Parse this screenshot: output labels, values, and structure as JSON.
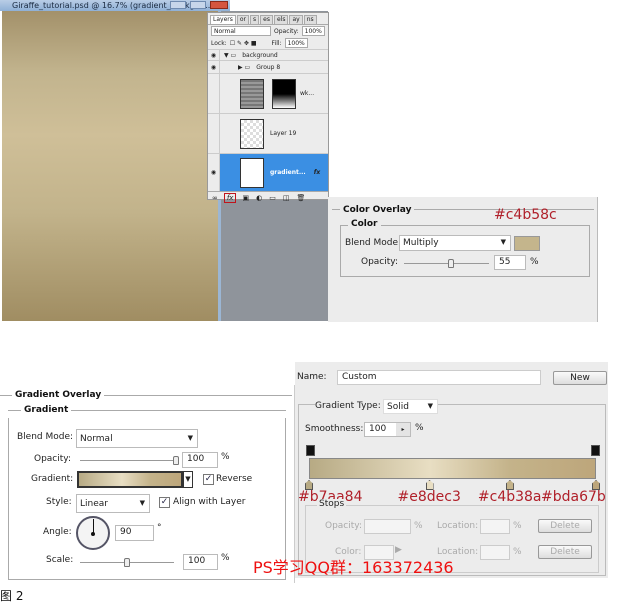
{
  "window": {
    "title": "Giraffe_tutorial.psd @ 16.7% (gradient_backgro...",
    "buttons": [
      "minimize",
      "maximize",
      "close"
    ]
  },
  "layers_panel": {
    "tabs": [
      "Layers",
      "or",
      "s",
      "es",
      "els",
      "ay",
      "ns"
    ],
    "blend_mode": "Normal",
    "opacity_label": "Opacity:",
    "opacity": "100%",
    "lock_label": "Lock:",
    "fill_label": "Fill:",
    "fill": "100%",
    "layers": [
      {
        "name": "background",
        "type": "group-open"
      },
      {
        "name": "Group 8",
        "type": "group"
      },
      {
        "name": "wk...",
        "type": "masked"
      },
      {
        "name": "Layer 19",
        "type": "layer"
      },
      {
        "name": "gradient...",
        "type": "selected",
        "fx": "fx"
      }
    ],
    "footer_icons": [
      "link-icon",
      "fx-icon",
      "mask-icon",
      "adjustment-icon",
      "folder-icon",
      "new-layer-icon",
      "trash-icon"
    ]
  },
  "color_overlay": {
    "title": "Color Overlay",
    "group": "Color",
    "blend_label": "Blend Mode:",
    "blend_mode": "Multiply",
    "color": "#c4b58c",
    "color_annotation": "#c4b58c",
    "opacity_label": "Opacity:",
    "opacity": "55",
    "opacity_pct": 55,
    "unit": "%"
  },
  "gradient_overlay": {
    "title": "Gradient Overlay",
    "group": "Gradient",
    "blend_label": "Blend Mode:",
    "blend_mode": "Normal",
    "opacity_label": "Opacity:",
    "opacity": "100",
    "unit": "%",
    "gradient_label": "Gradient:",
    "reverse_label": "Reverse",
    "reverse": true,
    "style_label": "Style:",
    "style": "Linear",
    "align_label": "Align with Layer",
    "align": true,
    "angle_label": "Angle:",
    "angle": "90",
    "degree": "°",
    "scale_label": "Scale:",
    "scale": "100",
    "scale_pct": 100
  },
  "gradient_editor": {
    "name_label": "Name:",
    "name": "Custom",
    "new_button": "New",
    "type_label": "Gradient Type:",
    "type": "Solid",
    "smooth_label": "Smoothness:",
    "smoothness": "100",
    "unit": "%",
    "stops": [
      {
        "color": "#b7aa84",
        "label": "#b7aa84",
        "location": 0
      },
      {
        "color": "#e8dec3",
        "label": "#e8dec3",
        "location": 42
      },
      {
        "color": "#c4b38a",
        "label": "#c4b38a",
        "location": 70
      },
      {
        "color": "#bda67b",
        "label": "#bda67b",
        "location": 100
      }
    ],
    "stops_group": "Stops",
    "opacity_label": "Opacity:",
    "location_label": "Location:",
    "color_label": "Color:",
    "delete_label": "Delete"
  },
  "watermark": "PS学习QQ群：163372436",
  "caption": "图 2"
}
